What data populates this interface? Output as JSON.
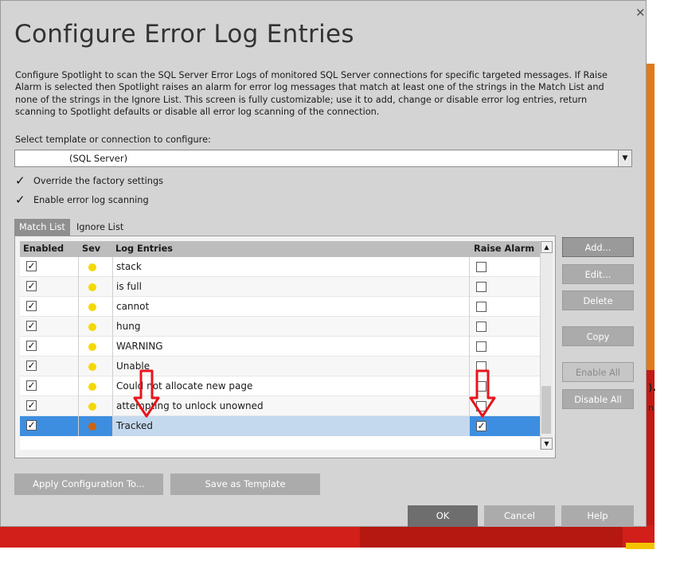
{
  "dialog": {
    "title": "Configure Error Log Entries",
    "close_glyph": "✕",
    "description": "Configure Spotlight to scan the SQL Server Error Logs of monitored SQL Server connections for specific targeted messages. If Raise Alarm is selected then Spotlight raises an alarm for error log messages that match at least one of the strings in the Match List and none of the strings in the Ignore List. This screen is fully customizable; use it to add, change or disable error log entries, return scanning to Spotlight defaults or disable all error log scanning of the connection.",
    "select_label": "Select template or connection to configure:",
    "select_value": "(SQL Server)",
    "override_label": "Override the factory settings",
    "override_checked": true,
    "enable_label": "Enable error log scanning",
    "enable_checked": true
  },
  "tabs": [
    {
      "label": "Match List",
      "active": true
    },
    {
      "label": "Ignore List",
      "active": false
    }
  ],
  "grid": {
    "columns": [
      "Enabled",
      "Sev",
      "Log Entries",
      "Raise Alarm"
    ],
    "rows": [
      {
        "enabled": true,
        "sev_color": "#f5d800",
        "entry": "stack",
        "raise_alarm": false
      },
      {
        "enabled": true,
        "sev_color": "#f5d800",
        "entry": "is full",
        "raise_alarm": false
      },
      {
        "enabled": true,
        "sev_color": "#f5d800",
        "entry": "cannot",
        "raise_alarm": false
      },
      {
        "enabled": true,
        "sev_color": "#f5d800",
        "entry": "hung",
        "raise_alarm": false
      },
      {
        "enabled": true,
        "sev_color": "#f5d800",
        "entry": "WARNING",
        "raise_alarm": false
      },
      {
        "enabled": true,
        "sev_color": "#f5d800",
        "entry": "Unable",
        "raise_alarm": false
      },
      {
        "enabled": true,
        "sev_color": "#f5d800",
        "entry": "Could not allocate new page",
        "raise_alarm": false
      },
      {
        "enabled": true,
        "sev_color": "#f5d800",
        "entry": "attempting to unlock unowned",
        "raise_alarm": false
      },
      {
        "enabled": true,
        "sev_color": "#d0620a",
        "entry": "Tracked",
        "raise_alarm": true,
        "selected": true
      }
    ]
  },
  "side_buttons": {
    "add": "Add...",
    "edit": "Edit...",
    "delete": "Delete",
    "copy": "Copy",
    "enable_all": "Enable All",
    "disable_all": "Disable All"
  },
  "bottom_buttons": {
    "apply": "Apply Configuration To...",
    "save_template": "Save as Template",
    "ok": "OK",
    "cancel": "Cancel",
    "help": "Help"
  },
  "background": {
    "right_text_1": ").",
    "right_text_2": "n"
  },
  "colors": {
    "annotation_arrow": "#e8141c",
    "selection": "#3d8ee0"
  }
}
